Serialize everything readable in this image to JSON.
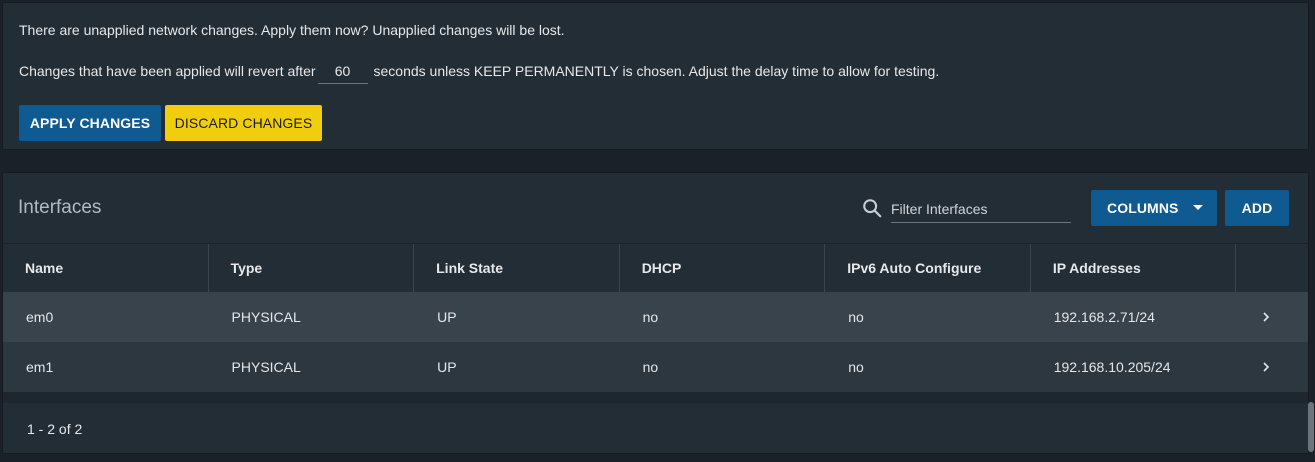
{
  "notice": {
    "line1": "There are unapplied network changes. Apply them now? Unapplied changes will be lost.",
    "line2_before": "Changes that have been applied will revert after",
    "delay_value": "60",
    "line2_after": "seconds unless KEEP PERMANENTLY is chosen. Adjust the delay time to allow for testing.",
    "apply_label": "APPLY CHANGES",
    "discard_label": "DISCARD CHANGES"
  },
  "interfaces": {
    "title": "Interfaces",
    "filter_placeholder": "Filter Interfaces",
    "columns_label": "COLUMNS",
    "add_label": "ADD",
    "columns": [
      "Name",
      "Type",
      "Link State",
      "DHCP",
      "IPv6 Auto Configure",
      "IP Addresses"
    ],
    "rows": [
      {
        "name": "em0",
        "type": "PHYSICAL",
        "link_state": "UP",
        "dhcp": "no",
        "ipv6": "no",
        "ip": "192.168.2.71/24"
      },
      {
        "name": "em1",
        "type": "PHYSICAL",
        "link_state": "UP",
        "dhcp": "no",
        "ipv6": "no",
        "ip": "192.168.10.205/24"
      }
    ],
    "pager": "1 - 2 of 2"
  },
  "icons": {
    "search": "search-icon",
    "caret": "caret-down-icon",
    "chevron": "chevron-right-icon"
  },
  "colors": {
    "primary": "#0e5a91",
    "warning": "#f0cd0d",
    "background": "#1a2128",
    "card": "#232d35"
  }
}
